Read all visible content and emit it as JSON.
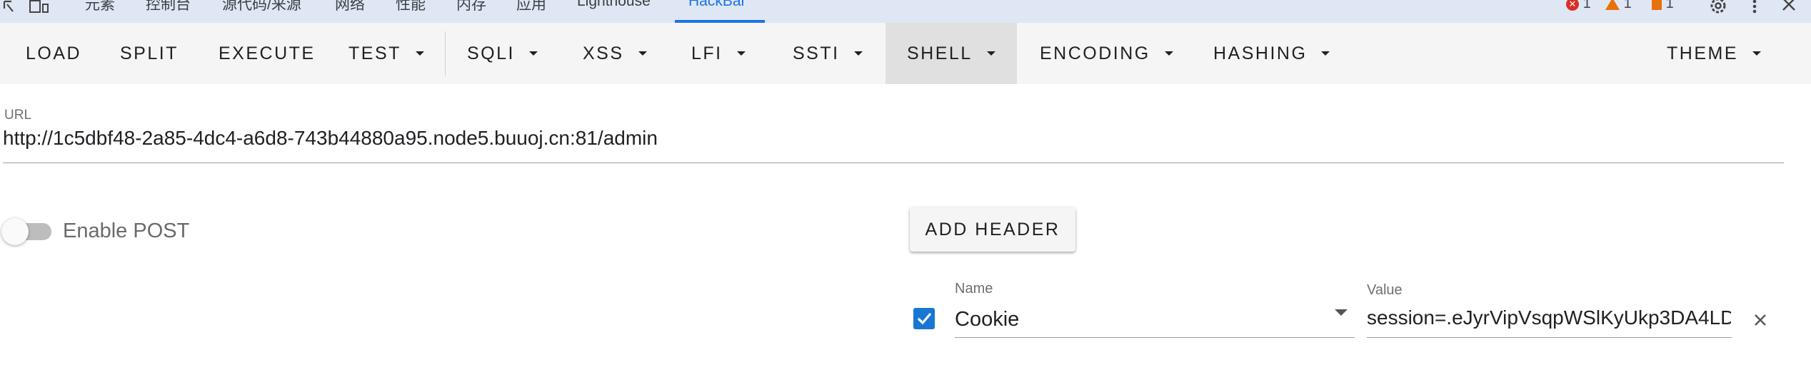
{
  "devtools": {
    "tabs": [
      "元素",
      "控制台",
      "源代码/来源",
      "网络",
      "性能",
      "内存",
      "应用",
      "Lighthouse",
      "HackBar"
    ],
    "active_tab": "HackBar",
    "errors_count": "1",
    "warnings_count": "1",
    "issues_count": "1",
    "icons": [
      "inspect-icon",
      "device-toggle-icon",
      "settings-icon",
      "more-icon",
      "close-icon"
    ]
  },
  "toolbar": {
    "load": "LOAD",
    "split": "SPLIT",
    "execute": "EXECUTE",
    "test": "TEST",
    "sqli": "SQLI",
    "xss": "XSS",
    "lfi": "LFI",
    "ssti": "SSTI",
    "shell": "SHELL",
    "encoding": "ENCODING",
    "hashing": "HASHING",
    "theme": "THEME"
  },
  "url": {
    "label": "URL",
    "value": "http://1c5dbf48-2a85-4dc4-a6d8-743b44880a95.node5.buuoj.cn:81/admin"
  },
  "post": {
    "label": "Enable POST",
    "enabled": false
  },
  "headers": {
    "add_label": "ADD HEADER",
    "rows": [
      {
        "checked": true,
        "name_label": "Name",
        "name": "Cookie",
        "value_label": "Value",
        "value": "session=.eJyrVipVsqpWSlKyUkp3DA4LD"
      }
    ]
  },
  "colors": {
    "accent": "#1a73e8",
    "checkbox": "#1976d2",
    "toolbar_bg": "#f5f5f5",
    "active_menu_bg": "#e0e0e0",
    "error": "#d93025",
    "warning": "#e8710a"
  }
}
